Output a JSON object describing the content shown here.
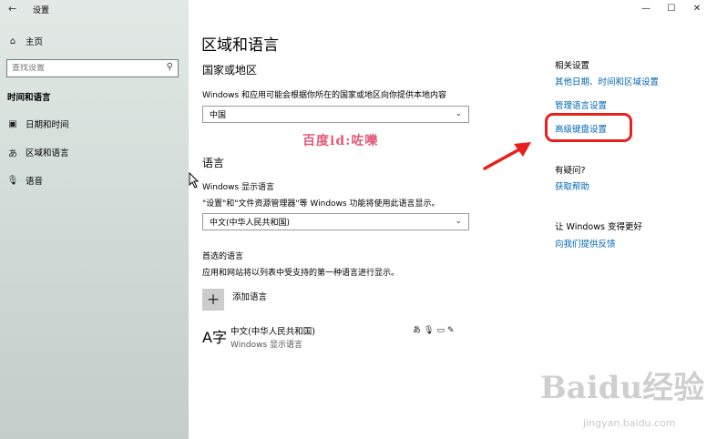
{
  "window": {
    "title": "设置",
    "controls": {
      "minimize": "—",
      "maximize": "☐",
      "close": "✕"
    }
  },
  "sidebar": {
    "home": "主页",
    "search_placeholder": "查找设置",
    "section": "时间和语言",
    "items": [
      {
        "label": "日期和时间",
        "icon": "calendar-clock-icon"
      },
      {
        "label": "区域和语言",
        "icon": "region-language-icon"
      },
      {
        "label": "语音",
        "icon": "microphone-icon"
      }
    ]
  },
  "main": {
    "title": "区域和语言",
    "country": {
      "heading": "国家或地区",
      "description": "Windows 和应用可能会根据你所在的国家或地区向你提供本地内容",
      "selected": "中国"
    },
    "language": {
      "heading": "语言",
      "display_label": "Windows 显示语言",
      "display_description": "\"设置\"和\"文件资源管理器\"等 Windows 功能将使用此语言显示。",
      "display_selected": "中文(中华人民共和国)",
      "preferred_label": "首选的语言",
      "preferred_description": "应用和网站将以列表中受支持的第一种语言进行显示。",
      "add_language": "添加语言",
      "languages": [
        {
          "name": "中文(中华人民共和国)",
          "sub": "Windows 显示语言"
        }
      ]
    }
  },
  "related": {
    "heading": "相关设置",
    "links": [
      "其他日期、时间和区域设置",
      "管理语言设置",
      "高级键盘设置"
    ],
    "help_heading": "有疑问?",
    "help_link": "获取帮助",
    "feedback_heading": "让 Windows 变得更好",
    "feedback_link": "向我们提供反馈"
  },
  "overlay": {
    "watermark": "百度id:咗嚛",
    "baidu_logo": "Baidu经验",
    "baidu_url": "jingyan.baidu.com"
  },
  "colors": {
    "link": "#0066b4",
    "highlight": "#e8201d",
    "watermark": "#e05a78"
  }
}
